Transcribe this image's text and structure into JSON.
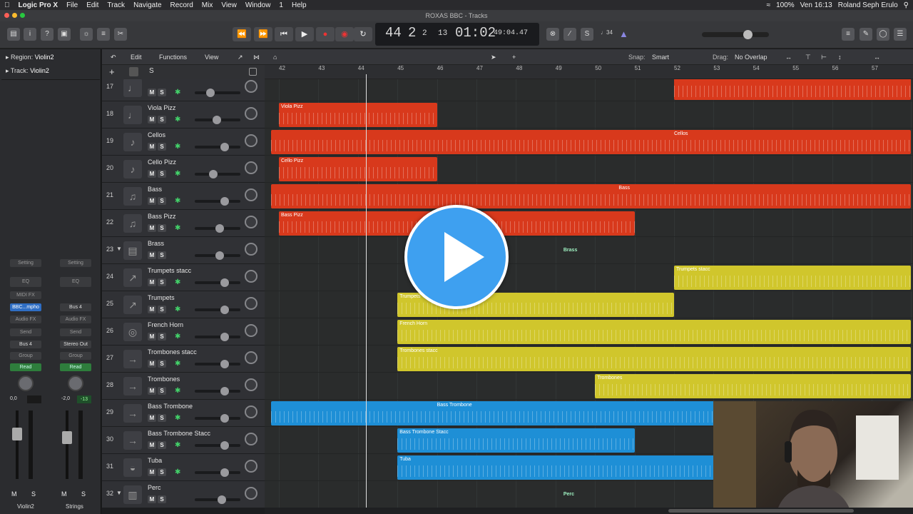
{
  "menubar": {
    "app": "Logic Pro X",
    "items": [
      "File",
      "Edit",
      "Track",
      "Navigate",
      "Record",
      "Mix",
      "View",
      "Window",
      "1",
      "Help"
    ],
    "battery": "100%",
    "datetime": "Ven 16:13",
    "user": "Roland Seph Erulo"
  },
  "window": {
    "title": "ROXAS BBC - Tracks"
  },
  "lcd": {
    "bar": "44",
    "beat": "2",
    "div": "2",
    "tick": "13",
    "time": "01:02",
    "time_frames": "49:04.47"
  },
  "toolbar": {
    "count_in": "♩34"
  },
  "inspector": {
    "region_label": "Region:",
    "region_name": "Violin2",
    "track_label": "Track:",
    "track_name": "Violin2",
    "strip1": {
      "setting": "Setting",
      "eq": "EQ",
      "midi_fx": "MIDI FX",
      "plugin": "BBC...mpho",
      "audio_fx": "Audio FX",
      "send": "Send",
      "output": "Bus 4",
      "group": "Group",
      "automation": "Read",
      "volume": "0,0",
      "pan_val": "",
      "m": "M",
      "s": "S",
      "name": "Violin2"
    },
    "strip2": {
      "setting": "Setting",
      "eq": "EQ",
      "input": "Bus 4",
      "audio_fx": "Audio FX",
      "send": "Send",
      "output": "Stereo Out",
      "group": "Group",
      "automation": "Read",
      "volume": "-2,0",
      "peak": "-13",
      "m": "M",
      "s": "S",
      "name": "Strings"
    }
  },
  "editbar": {
    "edit": "Edit",
    "functions": "Functions",
    "view": "View",
    "snap_label": "Snap:",
    "snap_value": "Smart",
    "drag_label": "Drag:",
    "drag_value": "No Overlap"
  },
  "trackheader": {
    "add": "+",
    "s": "S"
  },
  "ruler": {
    "bars": [
      "42",
      "43",
      "44",
      "45",
      "46",
      "47",
      "48",
      "49",
      "50",
      "51",
      "52",
      "53",
      "54",
      "55",
      "56",
      "57"
    ]
  },
  "tracks": [
    {
      "num": "17",
      "name": "",
      "fader": 0.3,
      "icon": "violin-icon"
    },
    {
      "num": "18",
      "name": "Viola Pizz",
      "fader": 0.48,
      "icon": "violin-icon"
    },
    {
      "num": "19",
      "name": "Cellos",
      "fader": 0.7,
      "icon": "cello-icon"
    },
    {
      "num": "20",
      "name": "Cello Pizz",
      "fader": 0.38,
      "icon": "cello-icon"
    },
    {
      "num": "21",
      "name": "Bass",
      "fader": 0.7,
      "icon": "bass-icon"
    },
    {
      "num": "22",
      "name": "Bass Pizz",
      "fader": 0.55,
      "icon": "bass-icon"
    },
    {
      "num": "23",
      "name": "Brass",
      "fader": 0.56,
      "icon": "brass-folder-icon",
      "folder": true
    },
    {
      "num": "24",
      "name": "Trumpets stacc",
      "fader": 0.7,
      "icon": "trumpet-icon"
    },
    {
      "num": "25",
      "name": "Trumpets",
      "fader": 0.7,
      "icon": "trumpet-icon"
    },
    {
      "num": "26",
      "name": "French Horn",
      "fader": 0.7,
      "icon": "horn-icon"
    },
    {
      "num": "27",
      "name": "Trombones stacc",
      "fader": 0.7,
      "icon": "trombone-icon"
    },
    {
      "num": "28",
      "name": "Trombones",
      "fader": 0.7,
      "icon": "trombone-icon"
    },
    {
      "num": "29",
      "name": "Bass Trombone",
      "fader": 0.7,
      "icon": "trombone-icon"
    },
    {
      "num": "30",
      "name": "Bass Trombone Stacc",
      "fader": 0.7,
      "icon": "trombone-icon"
    },
    {
      "num": "31",
      "name": "Tuba",
      "fader": 0.7,
      "icon": "tuba-icon"
    },
    {
      "num": "32",
      "name": "Perc",
      "fader": 0.62,
      "icon": "drum-folder-icon",
      "folder": true
    }
  ],
  "regions": [
    {
      "lane": 0,
      "start": 52.0,
      "end": 58.0,
      "label": "",
      "color": "#d8391c"
    },
    {
      "lane": 1,
      "start": 42.0,
      "end": 46.0,
      "label": "Viola Pizz",
      "color": "#d8391c"
    },
    {
      "lane": 2,
      "start": 41.8,
      "end": 58.0,
      "label": "Cellos",
      "color": "#d8391c",
      "label_at": 52.0
    },
    {
      "lane": 3,
      "start": 42.0,
      "end": 46.0,
      "label": "Cello Pizz",
      "color": "#d8391c"
    },
    {
      "lane": 4,
      "start": 41.8,
      "end": 58.0,
      "label": "Bass",
      "color": "#d8391c",
      "label_at": 50.6
    },
    {
      "lane": 5,
      "start": 42.0,
      "end": 51.0,
      "label": "Bass Pizz",
      "color": "#d8391c"
    },
    {
      "lane": 7,
      "start": 52.0,
      "end": 58.0,
      "label": "Trumpets stacc",
      "color": "#d0c62c"
    },
    {
      "lane": 8,
      "start": 45.0,
      "end": 52.0,
      "label": "Trumpets",
      "color": "#d0c62c"
    },
    {
      "lane": 9,
      "start": 45.0,
      "end": 58.0,
      "label": "French Horn",
      "color": "#d0c62c"
    },
    {
      "lane": 10,
      "start": 45.0,
      "end": 58.0,
      "label": "Trombones stacc",
      "color": "#d0c62c"
    },
    {
      "lane": 11,
      "start": 50.0,
      "end": 58.0,
      "label": "Trombones",
      "color": "#d0c62c"
    },
    {
      "lane": 12,
      "start": 41.8,
      "end": 58.0,
      "label": "Bass Trombone",
      "color": "#1e8fd6",
      "label_at": 46.0
    },
    {
      "lane": 13,
      "start": 45.0,
      "end": 51.0,
      "label": "Bass Trombone Stacc",
      "color": "#1e8fd6"
    },
    {
      "lane": 14,
      "start": 45.0,
      "end": 58.0,
      "label": "Tuba",
      "color": "#1e8fd6"
    }
  ],
  "folders": [
    {
      "lane": 6,
      "label": "Brass",
      "at": 49.2
    },
    {
      "lane": 15,
      "label": "Perc",
      "at": 49.2
    }
  ],
  "playhead_bar": 44.2,
  "colors": {
    "strings": "#d8391c",
    "brass": "#d0c62c",
    "low_brass": "#1e8fd6",
    "play_overlay": "#3ea0f0"
  }
}
